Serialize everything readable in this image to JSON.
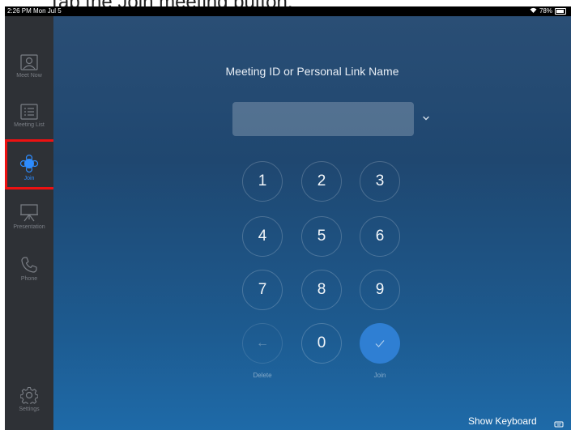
{
  "caption": "Tap the Join meeting button.",
  "status_bar": {
    "time": "2:26 PM  Mon Jul 5",
    "battery": "78%"
  },
  "sidebar": {
    "items": [
      {
        "label": "Meet Now",
        "icon": "meet-now-icon",
        "active": false
      },
      {
        "label": "Meeting List",
        "icon": "meeting-list-icon",
        "active": false
      },
      {
        "label": "Join",
        "icon": "join-icon",
        "active": true
      },
      {
        "label": "Presentation",
        "icon": "presentation-icon",
        "active": false
      },
      {
        "label": "Phone",
        "icon": "phone-icon",
        "active": false
      }
    ],
    "settings_label": "Settings"
  },
  "main": {
    "title": "Meeting ID or Personal Link Name",
    "input_value": "",
    "keypad": [
      "1",
      "2",
      "3",
      "4",
      "5",
      "6",
      "7",
      "8",
      "9",
      "0"
    ],
    "delete_label": "Delete",
    "join_label": "Join",
    "show_keyboard_label": "Show Keyboard"
  },
  "colors": {
    "accent": "#2d8cff",
    "sidebar_bg": "#2e3136",
    "join_button": "#2f7fd3",
    "highlight": "#ee1111"
  }
}
